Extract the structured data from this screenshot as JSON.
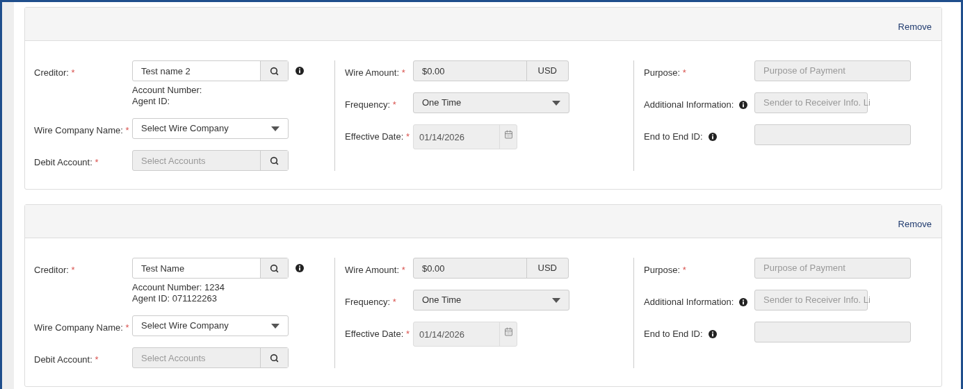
{
  "cards": [
    {
      "remove_link": "Remove",
      "columns": [
        [
          {
            "kind": "lookup",
            "label": "Creditor:",
            "required_mark": "*",
            "value": "Test name 2",
            "disabled": false,
            "info_after": true,
            "details": [
              "Account Number:",
              "Agent ID:"
            ]
          },
          {
            "kind": "select",
            "label": "Wire Company Name:",
            "required_mark": "*",
            "value": "Select Wire Company",
            "disabled": false
          },
          {
            "kind": "lookup",
            "label": "Debit Account:",
            "required_mark": "*",
            "placeholder": "Select Accounts",
            "disabled": true
          }
        ],
        [
          {
            "kind": "money",
            "label": "Wire Amount:",
            "required_mark": "*",
            "value": "$0.00",
            "addon": "USD",
            "disabled": true
          },
          {
            "kind": "select",
            "label": "Frequency:",
            "required_mark": "*",
            "value": "One Time",
            "disabled": true
          },
          {
            "kind": "date",
            "label": "Effective Date:",
            "required_mark": "*",
            "value": "01/14/2026",
            "disabled": true
          }
        ],
        [
          {
            "kind": "text",
            "label": "Purpose:",
            "required_mark": "*",
            "placeholder": "Purpose of Payment",
            "disabled": true
          },
          {
            "kind": "short-text",
            "label": "Additional Information:",
            "label_info": true,
            "placeholder": "Sender to Receiver Info. Li",
            "disabled": true
          },
          {
            "kind": "text",
            "label": "End to End ID:",
            "label_info": true,
            "disabled": true
          }
        ]
      ]
    },
    {
      "remove_link": "Remove",
      "columns": [
        [
          {
            "kind": "lookup",
            "label": "Creditor:",
            "required_mark": "*",
            "value": "Test Name",
            "disabled": false,
            "info_after": true,
            "details": [
              "Account Number: 1234",
              "Agent ID: 071122263"
            ]
          },
          {
            "kind": "select",
            "label": "Wire Company Name:",
            "required_mark": "*",
            "value": "Select Wire Company",
            "disabled": false
          },
          {
            "kind": "lookup",
            "label": "Debit Account:",
            "required_mark": "*",
            "placeholder": "Select Accounts",
            "disabled": true
          }
        ],
        [
          {
            "kind": "money",
            "label": "Wire Amount:",
            "required_mark": "*",
            "value": "$0.00",
            "addon": "USD",
            "disabled": true
          },
          {
            "kind": "select",
            "label": "Frequency:",
            "required_mark": "*",
            "value": "One Time",
            "disabled": true
          },
          {
            "kind": "date",
            "label": "Effective Date:",
            "required_mark": "*",
            "value": "01/14/2026",
            "disabled": true
          }
        ],
        [
          {
            "kind": "text",
            "label": "Purpose:",
            "required_mark": "*",
            "placeholder": "Purpose of Payment",
            "disabled": true
          },
          {
            "kind": "short-text",
            "label": "Additional Information:",
            "label_info": true,
            "placeholder": "Sender to Receiver Info. Li",
            "disabled": true
          },
          {
            "kind": "text",
            "label": "End to End ID:",
            "label_info": true,
            "disabled": true
          }
        ]
      ]
    }
  ]
}
